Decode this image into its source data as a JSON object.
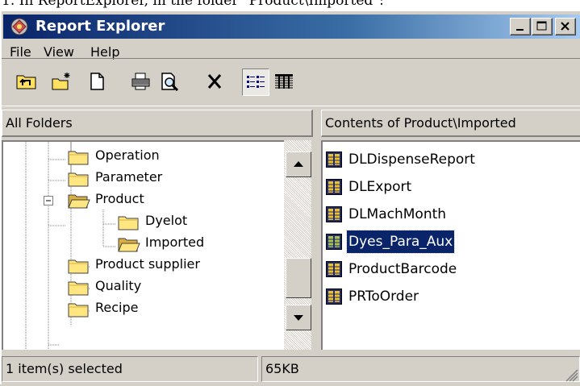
{
  "caption": "1. In ReportExplorer, in the folder \"Product\\Imported\":",
  "window": {
    "title": "Report Explorer",
    "title_icon": "report-explorer-app-icon"
  },
  "menu": [
    "File",
    "View",
    "Help"
  ],
  "toolbar": {
    "buttons": [
      "up-folder-icon",
      "new-folder-icon",
      "new-report-icon",
      "print-icon",
      "print-preview-icon",
      "delete-icon",
      "list-view-icon",
      "details-view-icon"
    ],
    "pressed": "list-view-icon"
  },
  "left_pane": {
    "header": "All Folders",
    "items": [
      {
        "label": "Operation",
        "level": 3
      },
      {
        "label": "Parameter",
        "level": 3
      },
      {
        "label": "Product",
        "level": 3,
        "expanded": true
      },
      {
        "label": "Dyelot",
        "level": 4
      },
      {
        "label": "Imported",
        "level": 4,
        "open": true
      },
      {
        "label": "Product supplier",
        "level": 3
      },
      {
        "label": "Quality",
        "level": 3
      },
      {
        "label": "Recipe",
        "level": 3,
        "partial": true
      }
    ]
  },
  "right_pane": {
    "header": "Contents of Product\\Imported",
    "items": [
      {
        "label": "DLDispenseReport",
        "selected": false
      },
      {
        "label": "DLExport",
        "selected": false
      },
      {
        "label": "DLMachMonth",
        "selected": false
      },
      {
        "label": "Dyes_Para_Aux",
        "selected": true
      },
      {
        "label": "ProductBarcode",
        "selected": false
      },
      {
        "label": "PRToOrder",
        "selected": false
      }
    ]
  },
  "status": {
    "selection": "1 item(s) selected",
    "size": "65KB"
  },
  "colors": {
    "title_start": "#0a246a",
    "title_end": "#a6caf0",
    "selection": "#0a246a",
    "face": "#d4d0c8",
    "folder": "#ffd966"
  }
}
